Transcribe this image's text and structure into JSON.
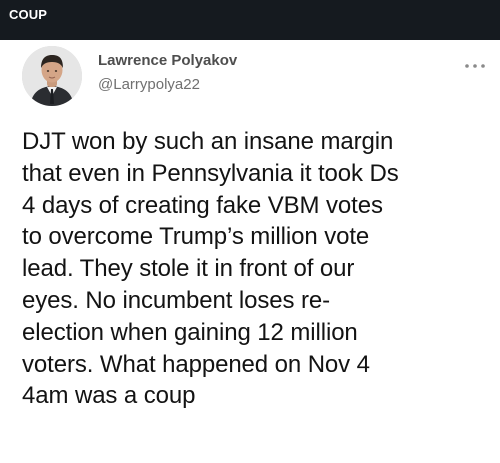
{
  "header": {
    "title": "COUP"
  },
  "tweet": {
    "author": {
      "display_name": "Lawrence Polyakov",
      "handle": "@Larrypolya22",
      "avatar_icon": "profile-photo"
    },
    "menu_icon": "more-horizontal-icon",
    "text": "DJT won by such an insane margin\nthat even in Pennsylvania it took Ds\n4 days of creating fake VBM votes\nto overcome Trump’s million vote\nlead. They stole it in front of our\neyes. No incumbent loses re-\nelection when gaining 12 million\nvoters. What happened on Nov 4\n4am was a coup"
  },
  "colors": {
    "top_bar": "#151a1f",
    "card_background": "#ffffff",
    "tweet_text": "#131313",
    "display_name": "#4e4e4e",
    "handle": "#707070",
    "menu_dots": "#8a8a8a"
  }
}
